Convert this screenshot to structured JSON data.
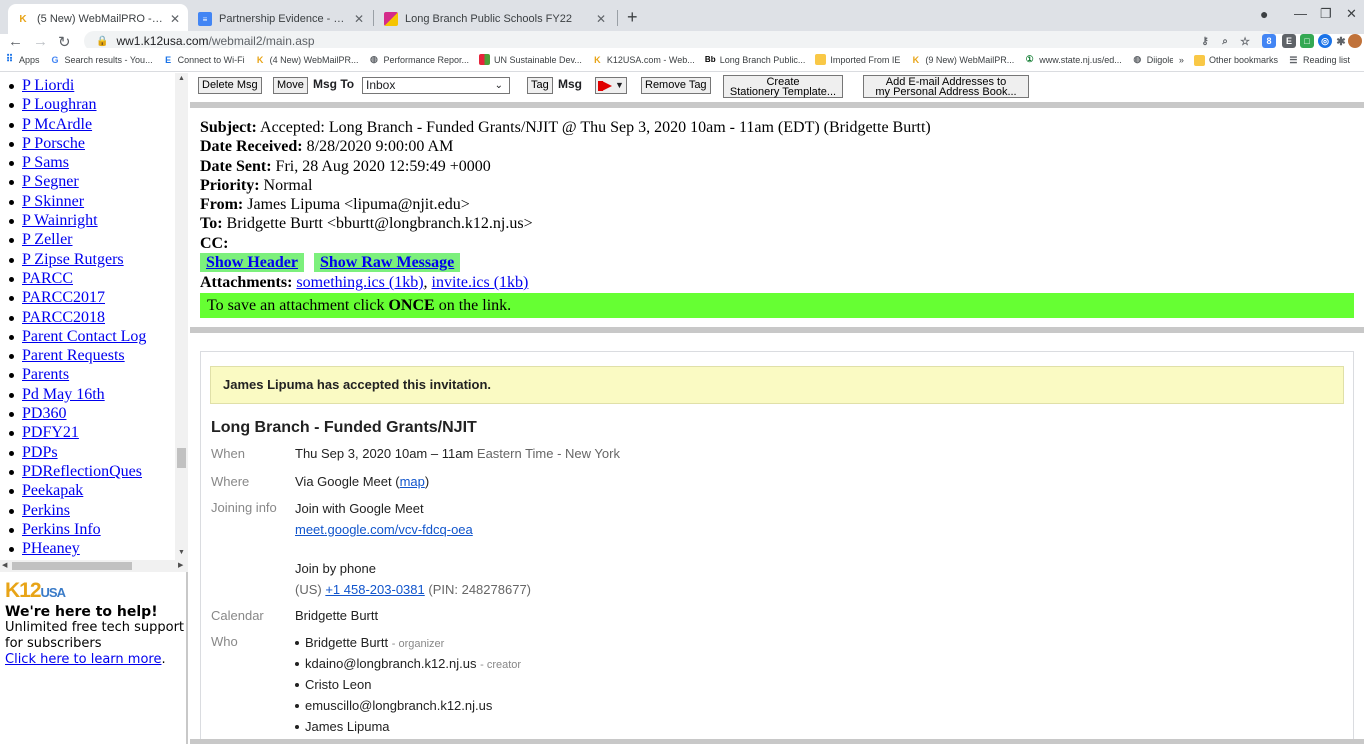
{
  "browser": {
    "tabs": [
      {
        "title": "(5 New) WebMailPRO - K12USA",
        "active": true
      },
      {
        "title": "Partnership Evidence - Google D",
        "active": false
      },
      {
        "title": "Long Branch Public Schools FY22",
        "active": false
      }
    ],
    "url_host": "ww1.k12usa.com",
    "url_path": "/webmail2/main.asp",
    "bookmarks": [
      "Apps",
      "Search results - You...",
      "Connect to Wi-Fi",
      "(4 New) WebMailPR...",
      "Performance Repor...",
      "UN Sustainable Dev...",
      "K12USA.com - Web...",
      "Long Branch Public...",
      "Imported From IE",
      "(9 New) WebMailPR...",
      "www.state.nj.us/ed...",
      "Diigolet"
    ],
    "bookmarks_more": "»",
    "other_bookmarks": "Other bookmarks",
    "reading_list": "Reading list"
  },
  "folders": [
    "P Liordi",
    "P Loughran",
    "P McArdle",
    "P Porsche",
    "P Sams",
    "P Segner",
    "P Skinner",
    "P Wainright",
    "P Zeller",
    "P Zipse Rutgers",
    "PARCC",
    "PARCC2017",
    "PARCC2018",
    "Parent Contact Log",
    "Parent Requests",
    "Parents",
    "Pd May 16th",
    "PD360",
    "PDFY21",
    "PDPs",
    "PDReflectionQues",
    "Peekapak",
    "Perkins",
    "Perkins Info",
    "PHeaney"
  ],
  "promo": {
    "logo_main": "K12",
    "logo_sub": "USA",
    "heading": "We're here to help!",
    "body": "Unlimited free tech support for subscribers",
    "link": "Click here to learn more",
    "end": "."
  },
  "toolbar": {
    "delete": "Delete Msg",
    "move": "Move",
    "msg_to_label": "Msg To",
    "folder_value": "Inbox",
    "tag": "Tag",
    "msg_label": "Msg",
    "remove_tag": "Remove Tag",
    "stationery_line1": "Create",
    "stationery_line2": "Stationery Template...",
    "address_line1": "Add E-mail Addresses to",
    "address_line2": "my Personal Address Book..."
  },
  "message": {
    "subject_label": "Subject:",
    "subject": "Accepted: Long Branch - Funded Grants/NJIT @ Thu Sep 3, 2020 10am - 11am (EDT) (Bridgette Burtt)",
    "received_label": "Date Received:",
    "received": "8/28/2020 9:00:00 AM",
    "sent_label": "Date Sent:",
    "sent": "Fri, 28 Aug 2020 12:59:49 +0000",
    "priority_label": "Priority:",
    "priority": "Normal",
    "from_label": "From:",
    "from": "James Lipuma <lipuma@njit.edu>",
    "to_label": "To:",
    "to": "Bridgette Burtt <bburtt@longbranch.k12.nj.us>",
    "cc_label": "CC:",
    "show_header": "Show Header",
    "show_raw": "Show Raw Message",
    "attachments_label": "Attachments:",
    "attachment1": "something.ics (1kb)",
    "attachment_sep": ",",
    "attachment2": "invite.ics (1kb)",
    "save_pre": "To save an attachment click",
    "save_bold": "ONCE",
    "save_post": "on the link."
  },
  "invite": {
    "accepted_banner": "James Lipuma has accepted this invitation.",
    "title": "Long Branch - Funded Grants/NJIT",
    "when_label": "When",
    "when": "Thu Sep 3, 2020 10am – 11am",
    "when_tz": "Eastern Time - New York",
    "where_label": "Where",
    "where": "Via Google Meet",
    "map_link": "map",
    "joining_label": "Joining info",
    "join_meet": "Join with Google Meet",
    "meet_link": "meet.google.com/vcv-fdcq-oea",
    "join_phone": "Join by phone",
    "phone_prefix": "(US)",
    "phone": "+1 458-203-0381",
    "pin": "(PIN: 248278677)",
    "calendar_label": "Calendar",
    "calendar": "Bridgette Burtt",
    "who_label": "Who",
    "who": [
      {
        "name": "Bridgette Burtt",
        "role": "- organizer"
      },
      {
        "name": "kdaino@longbranch.k12.nj.us",
        "role": "- creator"
      },
      {
        "name": "Cristo Leon",
        "role": ""
      },
      {
        "name": "emuscillo@longbranch.k12.nj.us",
        "role": ""
      },
      {
        "name": "James Lipuma",
        "role": ""
      }
    ]
  },
  "colors": {
    "accent_green": "#66ff33",
    "button_green": "#7cf07c",
    "banner_yellow": "#fafac3",
    "link_blue": "#0000ee"
  }
}
